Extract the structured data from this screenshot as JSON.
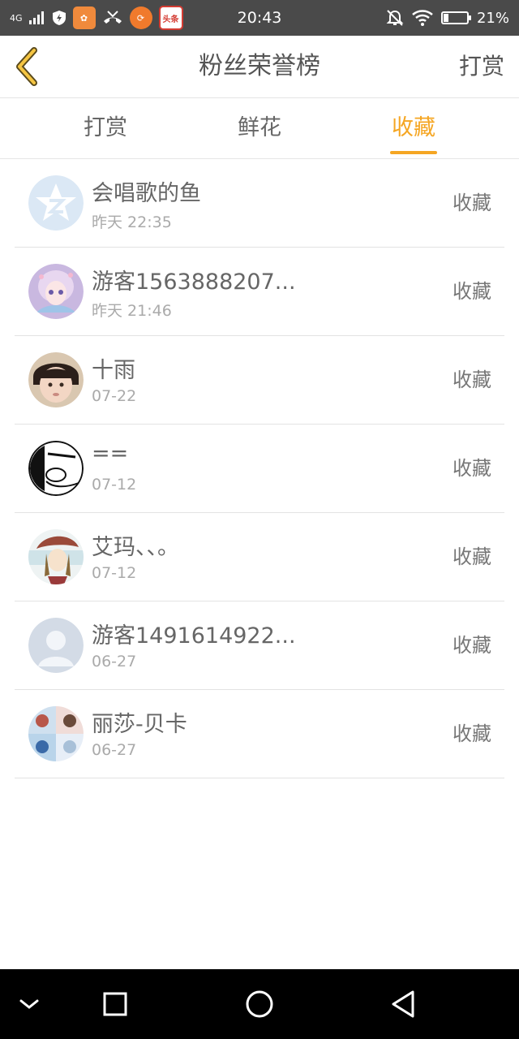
{
  "status_bar": {
    "network": "4G",
    "time": "20:43",
    "battery": "21%",
    "battery_level": 0.21,
    "news_app_label": "头条"
  },
  "header": {
    "title": "粉丝荣誉榜",
    "right_action": "打赏"
  },
  "tabs": [
    {
      "label": "打赏",
      "active": false
    },
    {
      "label": "鲜花",
      "active": false
    },
    {
      "label": "收藏",
      "active": true
    }
  ],
  "accent_color": "#f5a623",
  "fans": [
    {
      "name": "会唱歌的鱼",
      "time": "昨天 22:35",
      "action": "收藏",
      "avatar": "qq-star-avatar"
    },
    {
      "name": "游客1563888207...",
      "time": "昨天 21:46",
      "action": "收藏",
      "avatar": "anime-girl-avatar"
    },
    {
      "name": "十雨",
      "time": "07-22",
      "action": "收藏",
      "avatar": "child-photo-avatar"
    },
    {
      "name": "==",
      "time": "07-12",
      "action": "收藏",
      "avatar": "sketch-avatar"
    },
    {
      "name": "艾玛、、。",
      "time": "07-12",
      "action": "收藏",
      "avatar": "hat-girl-avatar"
    },
    {
      "name": "游客1491614922...",
      "time": "06-27",
      "action": "收藏",
      "avatar": "default-user-avatar"
    },
    {
      "name": "丽莎-贝卡",
      "time": "06-27",
      "action": "收藏",
      "avatar": "collage-avatar"
    }
  ],
  "nav": {
    "buttons": [
      "chevron-down-icon",
      "recent-apps-icon",
      "home-icon",
      "back-triangle-icon"
    ]
  }
}
